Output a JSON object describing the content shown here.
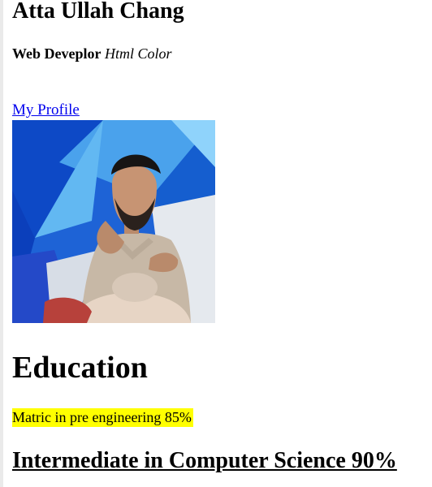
{
  "profile": {
    "name": "Atta Ullah Chang",
    "role": "Web Deveplor",
    "role_suffix": "Html Color",
    "link_label": "My Profile",
    "photo_alt": "Atta Ullah Chang profile photo"
  },
  "education": {
    "heading": "Education",
    "matric": "Matric in pre engineering 85%",
    "intermediate": "Intermediate in Computer Science 90%"
  },
  "colors": {
    "link": "#0000ee",
    "highlight": "#ffff00",
    "photo_background": "#1e63d6"
  }
}
